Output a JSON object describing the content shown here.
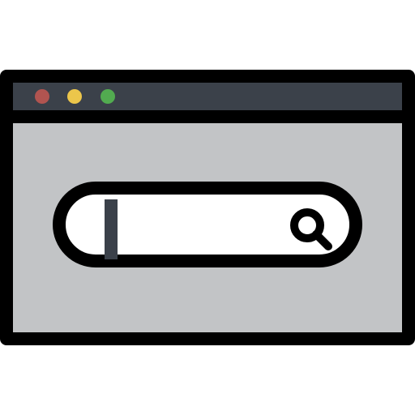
{
  "window": {
    "titlebar": {
      "dots": [
        {
          "name": "close-dot",
          "color": "#b15450"
        },
        {
          "name": "minimize-dot",
          "color": "#ecc64b"
        },
        {
          "name": "maximize-dot",
          "color": "#52ab50"
        }
      ],
      "color": "#3b414a"
    },
    "body_color": "#c2c4c6",
    "search": {
      "value": "",
      "placeholder": "",
      "icon": "search-icon",
      "cursor_color": "#3b414a"
    }
  }
}
